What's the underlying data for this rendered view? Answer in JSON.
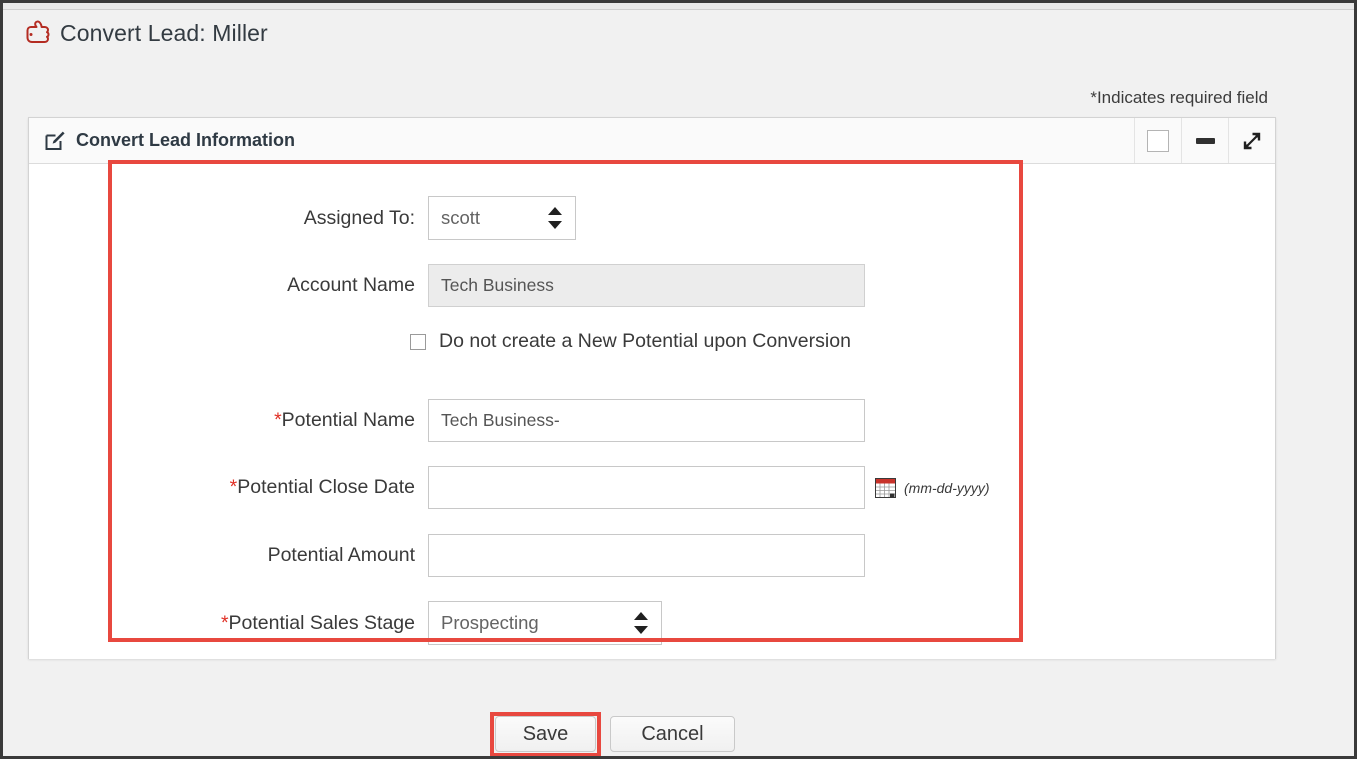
{
  "page": {
    "title": "Convert Lead: Miller",
    "title_icon": "pointing-hand-icon",
    "required_note": "*Indicates required field"
  },
  "panel": {
    "icon": "edit-pencil-icon",
    "title": "Convert Lead Information",
    "controls": [
      {
        "name": "restore-button",
        "icon": "square-icon"
      },
      {
        "name": "minimize-button",
        "icon": "dash-icon"
      },
      {
        "name": "expand-button",
        "icon": "diagonal-arrows-icon"
      }
    ]
  },
  "form": {
    "assigned_to": {
      "label": "Assigned To:",
      "value": "scott",
      "required": false
    },
    "account_name": {
      "label": "Account Name",
      "value": "Tech Business",
      "readonly": true,
      "required": false
    },
    "no_potential": {
      "label": "Do not create a New Potential upon Conversion",
      "checked": false
    },
    "potential_name": {
      "label": "Potential Name",
      "asterisk": "*",
      "value": "Tech Business-",
      "required": true
    },
    "potential_close_date": {
      "label": "Potential Close Date",
      "asterisk": "*",
      "value": "",
      "hint": "(mm-dd-yyyy)",
      "icon": "calendar-icon",
      "required": true
    },
    "potential_amount": {
      "label": "Potential Amount",
      "value": "",
      "required": false
    },
    "potential_sales_stage": {
      "label": "Potential Sales Stage",
      "asterisk": "*",
      "value": "Prospecting",
      "required": true
    }
  },
  "footer": {
    "save_label": "Save",
    "cancel_label": "Cancel"
  },
  "colors": {
    "highlight": "#e8483f",
    "required_asterisk": "#e03127",
    "title_icon": "#b42c22"
  }
}
